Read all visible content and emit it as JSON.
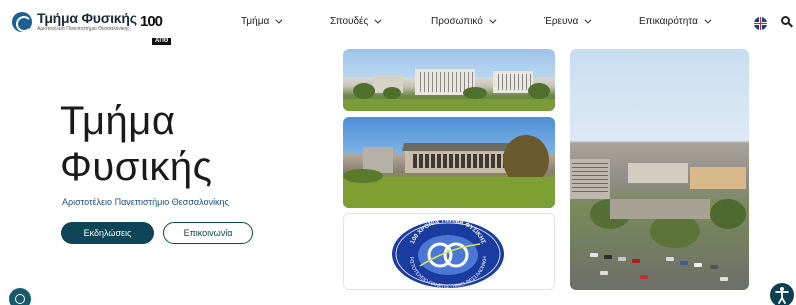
{
  "header": {
    "logo_title": "Τμήμα Φυσικής",
    "logo_subtitle": "Αριστοτέλειο Πανεπιστήμιο Θεσσαλονίκης",
    "anniversary_number": "100",
    "anniversary_word": "ΑΠΘ"
  },
  "nav": {
    "items": [
      {
        "label": "Τμήμα"
      },
      {
        "label": "Σπουδές"
      },
      {
        "label": "Προσωπικό"
      },
      {
        "label": "Έρευνα"
      },
      {
        "label": "Επικαιρότητα"
      }
    ]
  },
  "hero": {
    "title_line1": "Τμήμα",
    "title_line2": "Φυσικής",
    "subtitle": "Αριστοτέλειο Πανεπιστήμιο Θεσσαλονίκης",
    "primary_button": "Εκδηλώσεις",
    "secondary_button": "Επικοινωνία"
  },
  "seal": {
    "top_text": "100 ΧΡΟΝΙΑ ΤΜΗΜΑ ΦΥΣΙΚΗΣ",
    "bottom_text": "ΑΡΙΣΤΟΤΕΛΕΙΟ ΠΑΝΕΠΙΣΤΗΜΙΟ ΘΕΣΣΑΛΟΝΙΚΗΣ"
  },
  "icons": {
    "language": "uk-flag-icon",
    "search": "search-icon",
    "accessibility": "accessibility-icon",
    "cookie": "cookie-settings-icon"
  },
  "colors": {
    "brand_dark": "#0f4657",
    "brand_blue": "#1d5f93",
    "link_blue": "#1d4f7a"
  }
}
